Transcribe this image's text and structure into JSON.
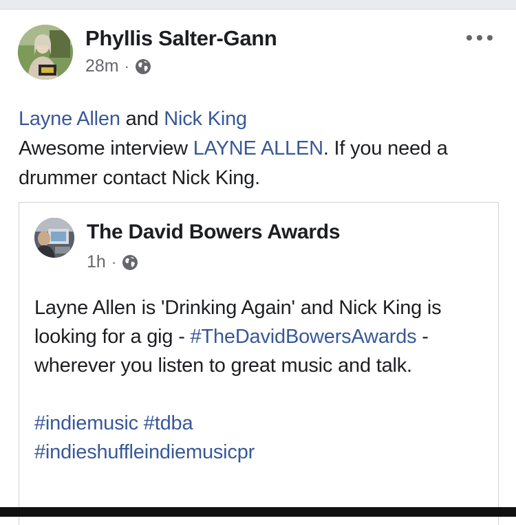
{
  "post": {
    "author": "Phyllis Salter-Gann",
    "time": "28m",
    "separator": "·",
    "privacy_icon": "globe-icon",
    "more_icon": "more-options-icon",
    "tag_1": "Layne Allen",
    "tag_and": " and ",
    "tag_2": "Nick King",
    "text_1": "Awesome interview ",
    "text_link": "LAYNE ALLEN",
    "text_2": ".  If you need a drummer contact Nick King."
  },
  "shared": {
    "page_name": "The David Bowers Awards",
    "time": "1h",
    "separator": "·",
    "privacy_icon": "globe-icon",
    "text_1": "Layne Allen is 'Drinking Again' and Nick King is looking for a gig - ",
    "hashtag_main": "#TheDavidBowersAwards",
    "text_2": " - wherever you listen to great music and talk.",
    "hashtag_1": "#indiemusic",
    "hashtag_2": "#tdba",
    "hashtag_3": "#indieshuffleindiemusicpr"
  },
  "colors": {
    "link": "#385898",
    "text": "#1c1e21",
    "meta": "#65676b"
  }
}
